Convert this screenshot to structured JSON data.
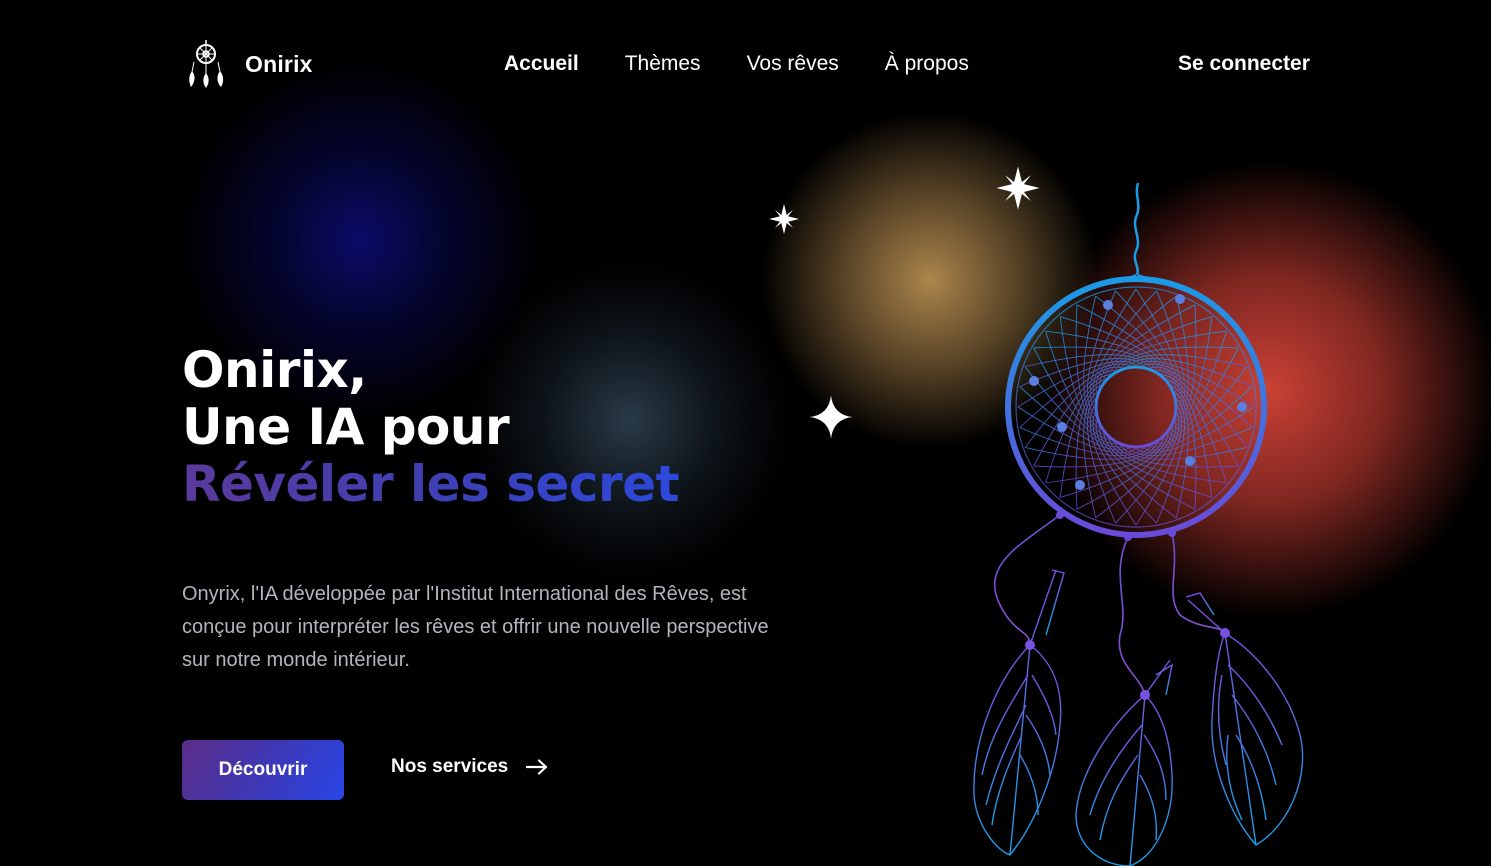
{
  "brand": {
    "name": "Onirix",
    "logo_icon": "dreamcatcher-icon"
  },
  "nav": {
    "links": [
      {
        "label": "Accueil",
        "active": true
      },
      {
        "label": "Thèmes",
        "active": false
      },
      {
        "label": "Vos rêves",
        "active": false
      },
      {
        "label": "À propos",
        "active": false
      }
    ],
    "login_label": "Se connecter"
  },
  "hero": {
    "title_line1": "Onirix,",
    "title_line2": "Une IA pour",
    "title_line3": "Révéler les secret",
    "description": "Onyrix, l'IA développée par l'Institut International des Rêves, est conçue pour interpréter les rêves et offrir une nouvelle perspective sur notre monde intérieur.",
    "primary_cta": "Découvrir",
    "secondary_cta": "Nos services",
    "secondary_icon": "arrow-right-icon"
  },
  "illustration": {
    "icon": "dreamcatcher-illustration",
    "sparkle_icon": "sparkle-icon"
  },
  "colors": {
    "background": "#000000",
    "accent_purple": "#5b2d86",
    "accent_blue": "#2846e6",
    "orb_blue": "#0c0c6e",
    "orb_slate": "#304454",
    "orb_gold": "#b48c50",
    "orb_red": "#ce4236",
    "body_text": "#b4b4bc"
  }
}
